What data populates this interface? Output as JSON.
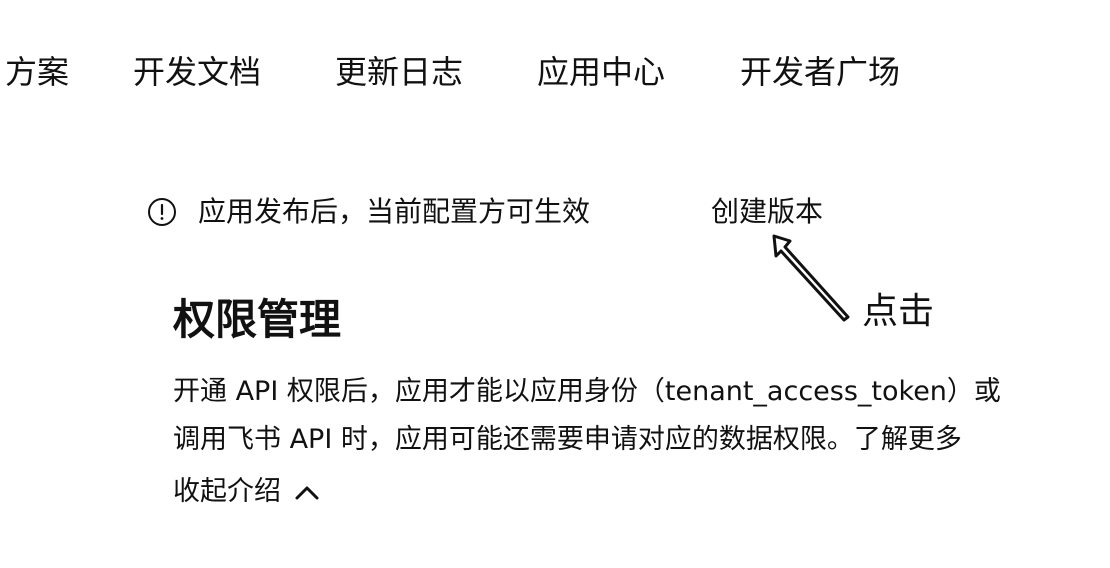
{
  "nav": {
    "items": [
      {
        "label": "方案",
        "cut": true
      },
      {
        "label": "开发文档"
      },
      {
        "label": "更新日志"
      },
      {
        "label": "应用中心"
      },
      {
        "label": "开发者广场"
      }
    ]
  },
  "notice": {
    "icon": "info-icon",
    "text": "应用发布后，当前配置方可生效",
    "action_label": "创建版本"
  },
  "annotation": {
    "icon": "arrow-annotation-icon",
    "label": "点击"
  },
  "permissions": {
    "title": "权限管理",
    "description_line1": "开通 API 权限后，应用才能以应用身份（tenant_access_token）或",
    "description_line2": "调用飞书 API 时，应用可能还需要申请对应的数据权限。了解更多",
    "collapse_label": "收起介绍",
    "collapse_icon": "chevron-up-icon"
  }
}
